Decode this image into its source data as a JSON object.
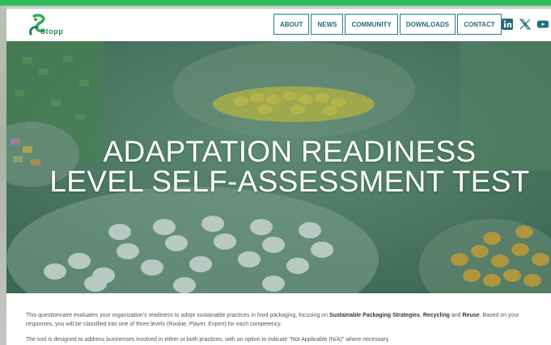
{
  "brand": {
    "logo_text": "Stopp",
    "accent": "#2fbf5a",
    "nav_border": "#2a7a86"
  },
  "nav": {
    "items": [
      {
        "label": "ABOUT"
      },
      {
        "label": "NEWS"
      },
      {
        "label": "COMMUNITY"
      },
      {
        "label": "DOWNLOADS"
      },
      {
        "label": "CONTACT"
      }
    ]
  },
  "socials": [
    {
      "icon": "linkedin-icon"
    },
    {
      "icon": "x-twitter-icon"
    },
    {
      "icon": "youtube-icon"
    }
  ],
  "hero": {
    "title_line1": "ADAPTATION READINESS",
    "title_line2": "LEVEL SELF-ASSESSMENT TEST"
  },
  "intro": {
    "p1_a": "This questionnaire evaluates your organization's readiness to adopt sustainable practices in food packaging, focusing on ",
    "p1_b1": "Sustainable Packaging Strategies",
    "p1_c": ", ",
    "p1_b2": "Recycling",
    "p1_d": " and ",
    "p1_b3": "Reuse",
    "p1_e": ". Based on your responses, you will be classified into one of three levels (Rookie, Player, Expert) for each competency.",
    "p2": "The tool is designed to address businesses involved in either or both practices, with an option to indicate \"Not Applicable (N/A)\" where necessary."
  }
}
